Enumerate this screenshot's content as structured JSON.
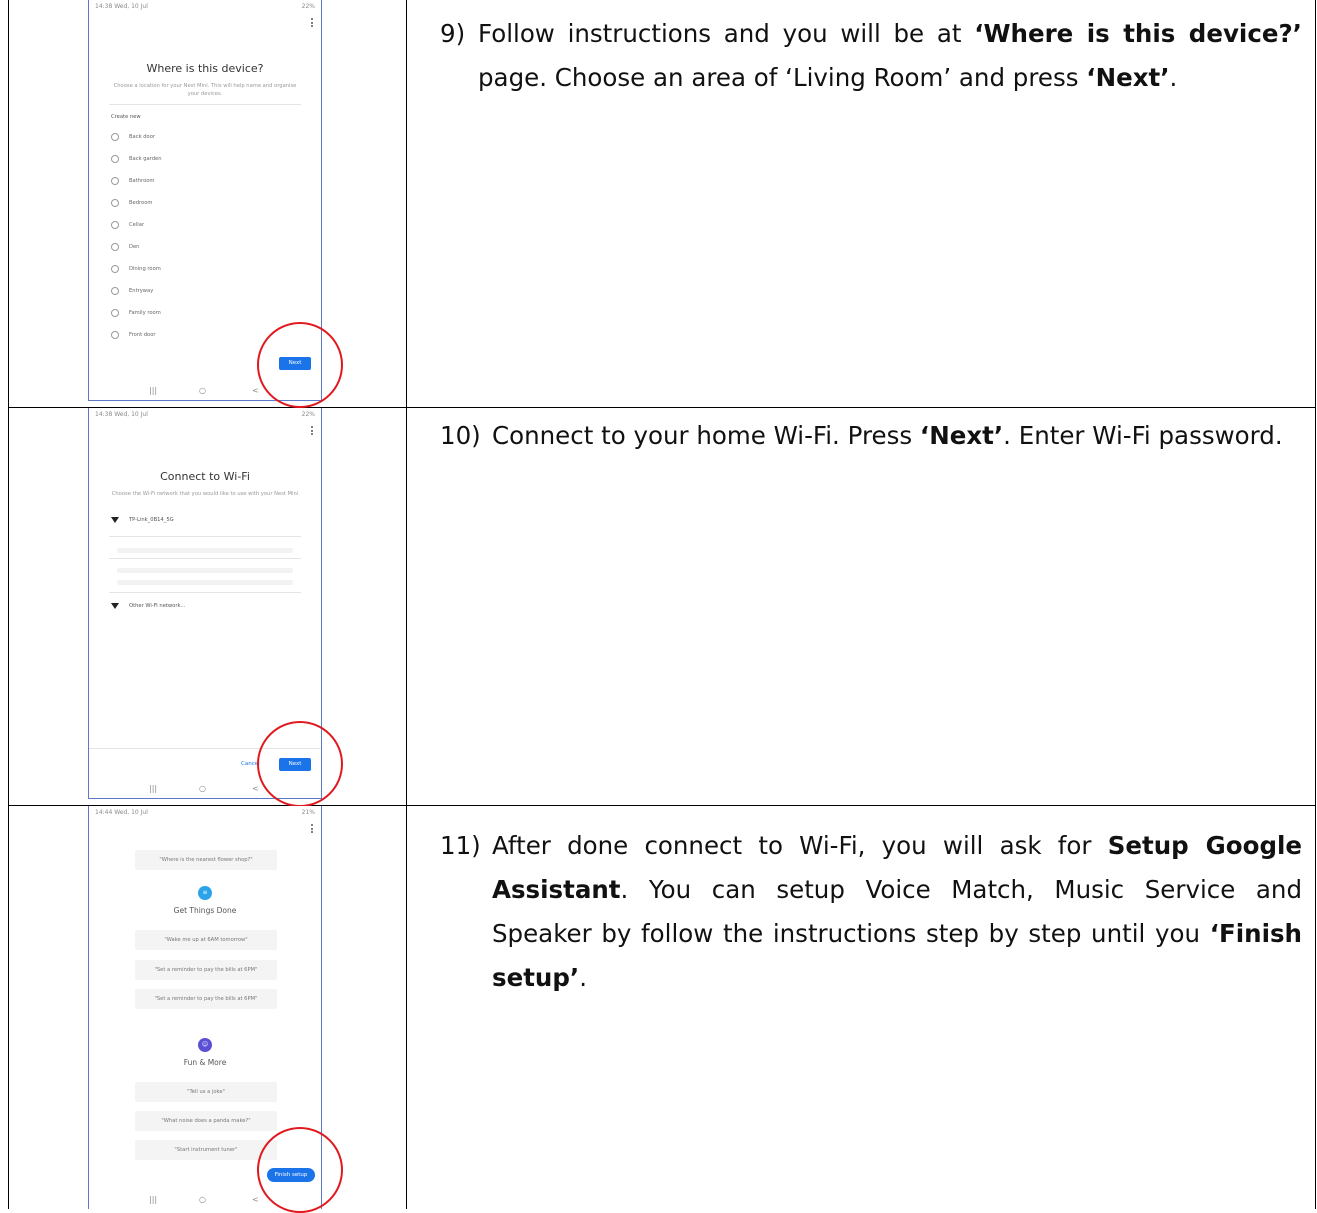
{
  "colors": {
    "accent": "#1a73e8",
    "highlight": "#e0191f",
    "frame": "#5b79c9",
    "assistant_purple": "#5b4fd6",
    "assistant_cyan": "#2aa3e8"
  },
  "steps": [
    {
      "number": "9)",
      "parts": [
        {
          "t": "Follow instructions and you will be at "
        },
        {
          "t": "‘Where is this device?’",
          "b": true
        },
        {
          "t": " page. Choose an area of ‘Living Room’ and press "
        },
        {
          "t": "‘Next’",
          "b": true
        },
        {
          "t": "."
        }
      ]
    },
    {
      "number": "10)",
      "parts": [
        {
          "t": "Connect to your home Wi-Fi. Press "
        },
        {
          "t": "‘Next’",
          "b": true
        },
        {
          "t": ". Enter Wi-Fi password."
        }
      ]
    },
    {
      "number": "11)",
      "parts": [
        {
          "t": "After done connect to Wi-Fi, you will ask for "
        },
        {
          "t": "Setup Google Assistant",
          "b": true
        },
        {
          "t": ". You can setup Voice Match, Music Service and Speaker by follow the instructions step by step until you "
        },
        {
          "t": "‘Finish setup’",
          "b": true
        },
        {
          "t": "."
        }
      ]
    }
  ],
  "screen1": {
    "status_time": "14:38 Wed, 10 Jul",
    "status_right": "22%",
    "title": "Where is this device?",
    "subtitle": "Choose a location for your Nest Mini. This will help name and organise your devices.",
    "section": "Create new",
    "options": [
      "Back door",
      "Back garden",
      "Bathroom",
      "Bedroom",
      "Cellar",
      "Den",
      "Dining room",
      "Entryway",
      "Family room",
      "Front door"
    ],
    "next_label": "Next",
    "nav": [
      "|||",
      "○",
      "<"
    ]
  },
  "screen2": {
    "status_time": "14:38 Wed, 10 Jul",
    "status_right": "22%",
    "title": "Connect to Wi-Fi",
    "subtitle": "Choose the Wi-Fi network that you would like to use with your Nest Mini",
    "network": "TP-Link_0B14_5G",
    "other": "Other Wi-Fi network...",
    "cancel_label": "Cancel",
    "next_label": "Next",
    "nav": [
      "|||",
      "○",
      "<"
    ]
  },
  "screen3": {
    "status_time": "14:44 Wed, 10 Jul",
    "status_right": "21%",
    "top_chip": "\"Where is the nearest flower shop?\"",
    "section1": "Get Things Done",
    "chips1": [
      "\"Wake me up at 6AM tomorrow\"",
      "\"Set a reminder to pay the bills at 6PM\"",
      "\"Set a reminder to pay the bills at 6PM\""
    ],
    "section2": "Fun & More",
    "chips2": [
      "\"Tell us a joke\"",
      "\"What noise does a panda make?\"",
      "\"Start instrument tuner\""
    ],
    "finish_label": "Finish setup",
    "nav": [
      "|||",
      "○",
      "<"
    ]
  }
}
